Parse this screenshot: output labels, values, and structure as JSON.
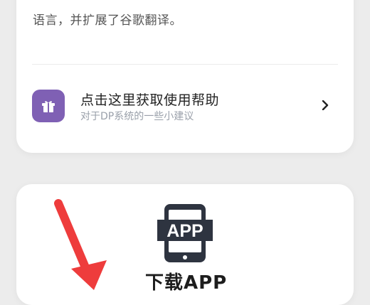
{
  "description_card": {
    "text_tail": "语言，并扩展了谷歌翻译。"
  },
  "help_item": {
    "icon": "gift-icon",
    "title": "点击这里获取使用帮助",
    "subtitle": "对于DP系统的一些小建议",
    "chevron": "chevron-right-icon"
  },
  "download_card": {
    "icon_label": "APP",
    "title": "下载APP"
  },
  "colors": {
    "accent_purple": "#7f60b4",
    "annotation_red": "#ee3c3c",
    "app_icon_dark": "#2e3440"
  }
}
